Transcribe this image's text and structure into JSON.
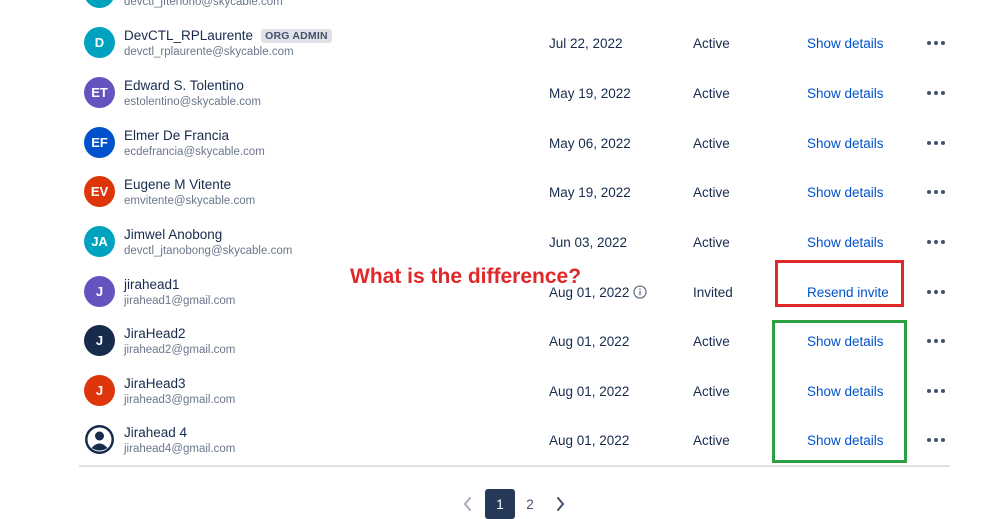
{
  "users": [
    {
      "initials": "",
      "avatar_color": "#00a3bf",
      "name": "",
      "email": "devctl_jftenorio@skycable.com",
      "badge": "",
      "date": "",
      "status": "",
      "action": "",
      "action_type": "link",
      "date_info": false
    },
    {
      "initials": "D",
      "avatar_color": "#00a3bf",
      "name": "DevCTL_RPLaurente",
      "email": "devctl_rplaurente@skycable.com",
      "badge": "ORG ADMIN",
      "date": "Jul 22, 2022",
      "status": "Active",
      "action": "Show details",
      "action_type": "link",
      "date_info": false
    },
    {
      "initials": "ET",
      "avatar_color": "#6554c0",
      "name": "Edward S. Tolentino",
      "email": "estolentino@skycable.com",
      "badge": "",
      "date": "May 19, 2022",
      "status": "Active",
      "action": "Show details",
      "action_type": "link",
      "date_info": false
    },
    {
      "initials": "EF",
      "avatar_color": "#0052cc",
      "name": "Elmer De Francia",
      "email": "ecdefrancia@skycable.com",
      "badge": "",
      "date": "May 06, 2022",
      "status": "Active",
      "action": "Show details",
      "action_type": "link",
      "date_info": false
    },
    {
      "initials": "EV",
      "avatar_color": "#de350b",
      "name": "Eugene M Vitente",
      "email": "emvitente@skycable.com",
      "badge": "",
      "date": "May 19, 2022",
      "status": "Active",
      "action": "Show details",
      "action_type": "link",
      "date_info": false
    },
    {
      "initials": "JA",
      "avatar_color": "#00a3bf",
      "name": "Jimwel Anobong",
      "email": "devctl_jtanobong@skycable.com",
      "badge": "",
      "date": "Jun 03, 2022",
      "status": "Active",
      "action": "Show details",
      "action_type": "link",
      "date_info": false
    },
    {
      "initials": "J",
      "avatar_color": "#6554c0",
      "name": "jirahead1",
      "email": "jirahead1@gmail.com",
      "badge": "",
      "date": "Aug 01, 2022",
      "status": "Invited",
      "action": "Resend invite",
      "action_type": "link",
      "date_info": true
    },
    {
      "initials": "J",
      "avatar_color": "#172b4d",
      "name": "JiraHead2",
      "email": "jirahead2@gmail.com",
      "badge": "",
      "date": "Aug 01, 2022",
      "status": "Active",
      "action": "Show details",
      "action_type": "link",
      "date_info": false
    },
    {
      "initials": "J",
      "avatar_color": "#de350b",
      "name": "JiraHead3",
      "email": "jirahead3@gmail.com",
      "badge": "",
      "date": "Aug 01, 2022",
      "status": "Active",
      "action": "Show details",
      "action_type": "link",
      "date_info": false
    },
    {
      "initials": "",
      "avatar_color": "#172b4d",
      "avatar_icon": "person-icon",
      "name": "Jirahead 4",
      "email": "jirahead4@gmail.com",
      "badge": "",
      "date": "Aug 01, 2022",
      "status": "Active",
      "action": "Show details",
      "action_type": "link",
      "date_info": false
    }
  ],
  "annotation": {
    "text": "What is the difference?",
    "text_color": "#e0282a",
    "red_box_color": "#e0282a",
    "green_box_color": "#2ea043"
  },
  "pagination": {
    "pages": [
      "1",
      "2"
    ],
    "current": "1",
    "prev_icon": "chevron-left-icon",
    "next_icon": "chevron-right-icon"
  },
  "colors": {
    "link": "#0052cc",
    "text": "#172b4d",
    "subtle": "#6b778c",
    "pager_active": "#253858"
  }
}
